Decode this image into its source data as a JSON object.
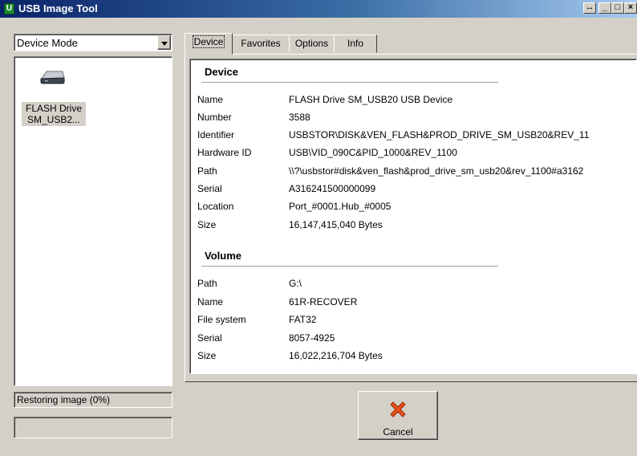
{
  "window": {
    "title": "USB Image Tool",
    "app_icon": "U"
  },
  "titlebar_buttons": {
    "resize": "↔",
    "minimize": "_",
    "maximize": "□",
    "close": "×"
  },
  "mode_select": {
    "value": "Device Mode"
  },
  "device_list": [
    {
      "label": "FLASH Drive SM_USB2...",
      "icon": "usb-drive-icon"
    }
  ],
  "status": {
    "text": "Restoring image (0%)",
    "progress": 0
  },
  "tabs": [
    {
      "label": "Device",
      "active": true
    },
    {
      "label": "Favorites",
      "active": false
    },
    {
      "label": "Options",
      "active": false
    },
    {
      "label": "Info",
      "active": false
    }
  ],
  "device_section": {
    "title": "Device",
    "rows": [
      {
        "label": "Name",
        "value": "FLASH Drive SM_USB20 USB Device"
      },
      {
        "label": "Number",
        "value": "3588"
      },
      {
        "label": "Identifier",
        "value": "USBSTOR\\DISK&VEN_FLASH&PROD_DRIVE_SM_USB20&REV_11"
      },
      {
        "label": "Hardware ID",
        "value": "USB\\VID_090C&PID_1000&REV_1100"
      },
      {
        "label": "Path",
        "value": "\\\\?\\usbstor#disk&ven_flash&prod_drive_sm_usb20&rev_1100#a3162"
      },
      {
        "label": "Serial",
        "value": "A316241500000099"
      },
      {
        "label": "Location",
        "value": "Port_#0001.Hub_#0005"
      },
      {
        "label": "Size",
        "value": "16,147,415,040 Bytes"
      }
    ]
  },
  "volume_section": {
    "title": "Volume",
    "rows": [
      {
        "label": "Path",
        "value": "G:\\"
      },
      {
        "label": "Name",
        "value": "61R-RECOVER"
      },
      {
        "label": "File system",
        "value": "FAT32"
      },
      {
        "label": "Serial",
        "value": "8057-4925"
      },
      {
        "label": "Size",
        "value": "16,022,216,704 Bytes"
      }
    ]
  },
  "cancel_button": {
    "label": "Cancel",
    "icon": "red-x-icon"
  },
  "colors": {
    "titlebar_start": "#0a246a",
    "titlebar_end": "#a6caf0",
    "face": "#d4d0c8",
    "cancel_icon": "#e8501a"
  }
}
